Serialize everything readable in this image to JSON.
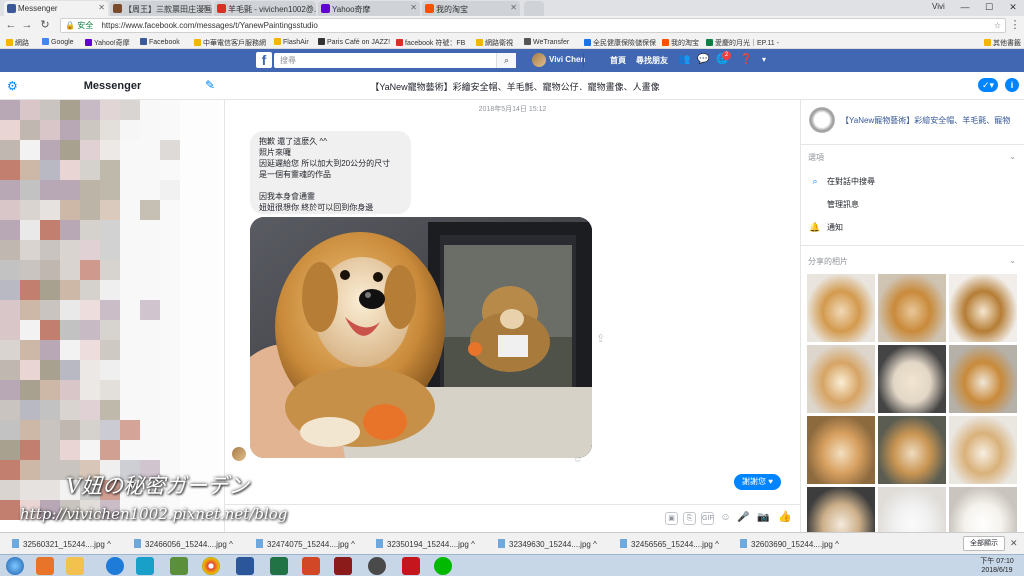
{
  "browser": {
    "tabs": [
      {
        "label": "Messenger",
        "active": true,
        "color": "#3b5998"
      },
      {
        "label": "【周王】三款票田庄漫画",
        "active": false,
        "color": "#7a4b2a"
      },
      {
        "label": "羊毛氈 - vivichen1002@...",
        "active": false,
        "color": "#d93025"
      },
      {
        "label": "Yahoo奇摩",
        "active": false,
        "color": "#6001d2"
      },
      {
        "label": "我的淘宝",
        "active": false,
        "color": "#ff5000"
      }
    ],
    "window_controls": {
      "user": "Vivi",
      "minimize": "—",
      "maximize": "☐",
      "close": "✕"
    },
    "address": {
      "secure_label": "安全",
      "url": "https://www.facebook.com/messages/t/YanewPaintingsstudio"
    },
    "bookmarks": [
      {
        "label": "網路",
        "color": "#f4b400"
      },
      {
        "label": "Google",
        "color": "#f4b400"
      },
      {
        "label": "Yahoo!奇摩",
        "color": "#6001d2"
      },
      {
        "label": "Facebook",
        "color": "#3b5998"
      },
      {
        "label": "中華電信客戶服務網",
        "color": "#f4b400"
      },
      {
        "label": "FlashAir",
        "color": "#f4b400"
      },
      {
        "label": "Paris Café on JAZZ!",
        "color": "#333333"
      },
      {
        "label": "facebook 符號：FB",
        "color": "#d93025"
      },
      {
        "label": "網路衛視",
        "color": "#f4b400"
      },
      {
        "label": "WeTransfer",
        "color": "#555555"
      },
      {
        "label": "全民健康保險儲保保",
        "color": "#1a73e8"
      },
      {
        "label": "我的淘宝",
        "color": "#ff5000"
      },
      {
        "label": "愛慶的月光｜EP.11 -",
        "color": "#0b8043"
      }
    ],
    "other_bookmarks": "其他書籤"
  },
  "facebook": {
    "search_placeholder": "搜尋",
    "user_name": "Vivi Chen",
    "nav_home": "首頁",
    "nav_find_friends": "尋找朋友",
    "notification_badge": "2"
  },
  "messenger": {
    "title": "Messenger",
    "conversation_title": "【YaNew寵物藝術】彩繪安全帽、羊毛氈、寵物公仔．寵物畫像、人畫像",
    "date_label": "2018年5月14日 15:12",
    "message_lines": [
      "抱歉 還了這麼久 ^^",
      "照片來囉",
      "因延遲給您 所以加大到20公分的尺寸",
      "是一個有靈魂的作品",
      "",
      "因我本身會通靈",
      "妞妞很想你 終於可以回到你身邊"
    ],
    "reply_text": "謝謝您",
    "reply_emoji": "♥"
  },
  "right_panel": {
    "group_name": "【YaNew寵物藝術】彩繪安全帽、羊毛氈、寵物",
    "options_header": "選項",
    "options": [
      {
        "label": "在對話中搜尋",
        "icon": "search-icon"
      },
      {
        "label": "管理訊息",
        "icon": "none"
      },
      {
        "label": "通知",
        "icon": "bell-icon"
      }
    ],
    "photos_header": "分享的相片"
  },
  "watermark": {
    "line1": "V妞の秘密ガーデン",
    "line2": "http://vivichen1002.pixnet.net/blog"
  },
  "downloads": {
    "items": [
      "32560321_15244....jpg",
      "32466056_15244....jpg",
      "32474075_15244....jpg",
      "32350194_15244....jpg",
      "32349630_15244....jpg",
      "32456565_15244....jpg",
      "32603690_15244....jpg"
    ],
    "show_all": "全部顯示"
  },
  "taskbar": {
    "time": "下午 07:10",
    "date": "2018/6/19"
  },
  "colors": {
    "fb_blue": "#4267b2",
    "messenger_blue": "#0084ff"
  }
}
